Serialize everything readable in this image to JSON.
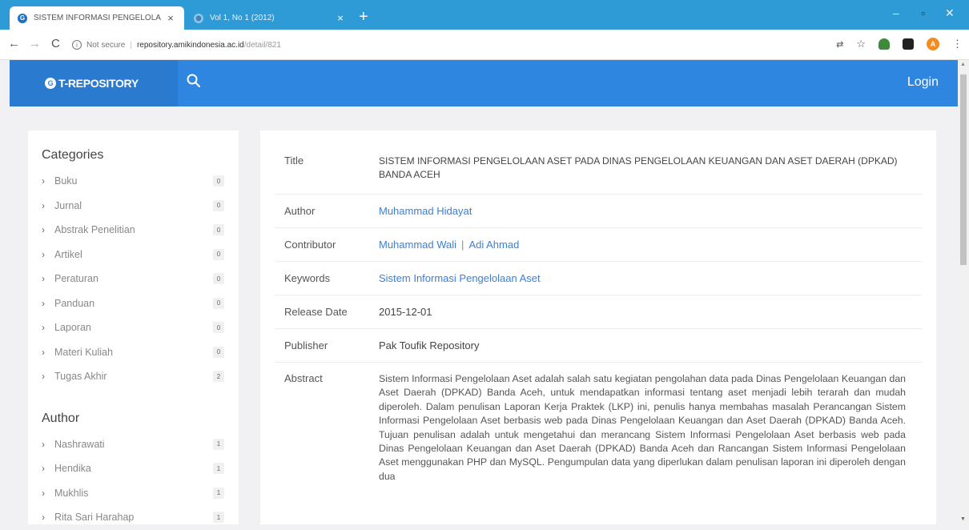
{
  "browser": {
    "tabs": [
      {
        "title": "SISTEM INFORMASI PENGELOLA",
        "favicon": "G"
      },
      {
        "title": "Vol 1, No 1 (2012)"
      }
    ],
    "address": {
      "secure_label": "Not secure",
      "host": "repository.amikindonesia.ac.id",
      "path": "/detail/821"
    },
    "profile_initial": "A"
  },
  "header": {
    "brand_logo": "G",
    "brand": "T-REPOSITORY",
    "login": "Login",
    "accent": "#2f86e0"
  },
  "sidebar": {
    "categories_heading": "Categories",
    "categories": [
      {
        "label": "Buku",
        "count": "0"
      },
      {
        "label": "Jurnal",
        "count": "0"
      },
      {
        "label": "Abstrak Penelitian",
        "count": "0"
      },
      {
        "label": "Artikel",
        "count": "0"
      },
      {
        "label": "Peraturan",
        "count": "0"
      },
      {
        "label": "Panduan",
        "count": "0"
      },
      {
        "label": "Laporan",
        "count": "0"
      },
      {
        "label": "Materi Kuliah",
        "count": "0"
      },
      {
        "label": "Tugas Akhir",
        "count": "2"
      }
    ],
    "author_heading": "Author",
    "authors": [
      {
        "label": "Nashrawati",
        "count": "1"
      },
      {
        "label": "Hendika",
        "count": "1"
      },
      {
        "label": "Mukhlis",
        "count": "1"
      },
      {
        "label": "Rita Sari Harahap",
        "count": "1"
      }
    ]
  },
  "detail": {
    "title_label": "Title",
    "title": "SISTEM INFORMASI PENGELOLAAN ASET PADA DINAS PENGELOLAAN KEUANGAN DAN ASET DAERAH (DPKAD) BANDA ACEH",
    "author_label": "Author",
    "author": "Muhammad Hidayat",
    "contributor_label": "Contributor",
    "contributors": [
      "Muhammad Wali",
      "Adi Ahmad"
    ],
    "contributor_sep": "|",
    "keywords_label": "Keywords",
    "keywords": "Sistem Informasi Pengelolaan Aset",
    "release_label": "Release Date",
    "release_date": "2015-12-01",
    "publisher_label": "Publisher",
    "publisher": "Pak Toufik Repository",
    "abstract_label": "Abstract",
    "abstract": "Sistem Informasi Pengelolaan Aset adalah salah satu kegiatan pengolahan data pada Dinas Pengelolaan Keuangan dan Aset Daerah (DPKAD) Banda Aceh, untuk mendapatkan informasi tentang aset menjadi lebih terarah dan mudah diperoleh. Dalam penulisan Laporan Kerja Praktek (LKP) ini, penulis hanya membahas masalah Perancangan Sistem Informasi Pengelolaan Aset berbasis web pada Dinas Pengelolaan Keuangan dan Aset Daerah (DPKAD) Banda Aceh. Tujuan penulisan adalah untuk mengetahui dan merancang Sistem Informasi Pengelolaan Aset berbasis web pada Dinas Pengelolaan Keuangan dan Aset Daerah (DPKAD) Banda Aceh dan Rancangan Sistem Informasi Pengelolaan Aset menggunakan PHP dan MySQL. Pengumpulan data yang diperlukan dalam penulisan laporan ini diperoleh dengan dua"
  }
}
